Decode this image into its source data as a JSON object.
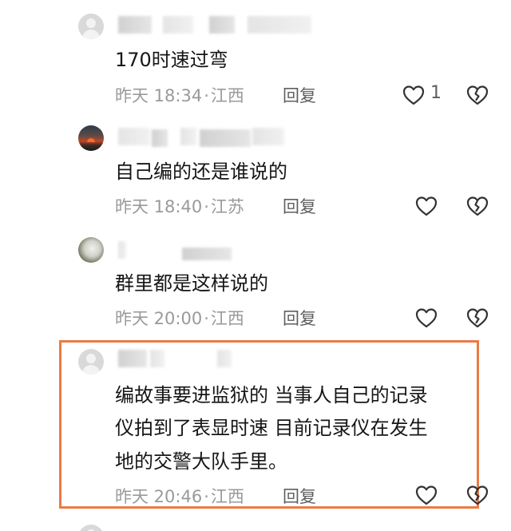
{
  "comments": [
    {
      "text": "170时速过弯",
      "time": "昨天 18:34",
      "location": "江西",
      "reply_label": "回复",
      "like_count": "1"
    },
    {
      "text": "自己编的还是谁说的",
      "time": "昨天 18:40",
      "location": "江苏",
      "reply_label": "回复"
    },
    {
      "text": "群里都是这样说的",
      "time": "昨天 20:00",
      "location": "江西",
      "reply_label": "回复"
    },
    {
      "text_lines": [
        "编故事要进监狱的 当事人自己的记录",
        "仪拍到了表显时速 目前记录仪在发生",
        "地的交警大队手里。"
      ],
      "time": "昨天 20:46",
      "location": "江西",
      "reply_label": "回复"
    }
  ],
  "colors": {
    "highlight": "#ec7a45",
    "meta": "#9a9a9a"
  },
  "icons": {
    "like": "heart-outline-icon",
    "dislike": "broken-heart-icon"
  }
}
